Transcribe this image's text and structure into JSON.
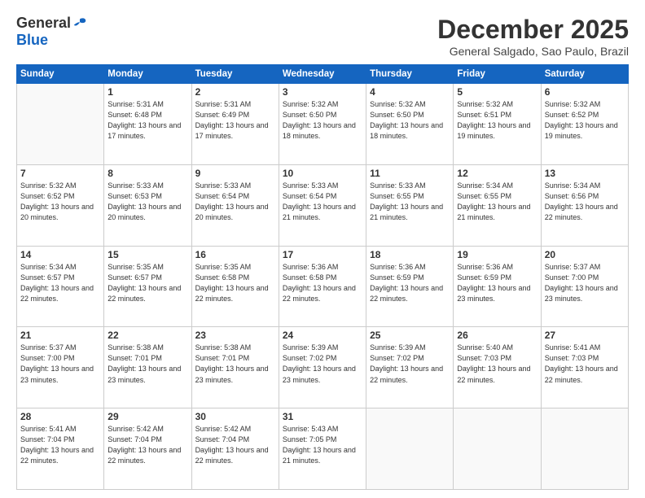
{
  "header": {
    "logo_line1": "General",
    "logo_line2": "Blue",
    "month_year": "December 2025",
    "location": "General Salgado, Sao Paulo, Brazil"
  },
  "days_of_week": [
    "Sunday",
    "Monday",
    "Tuesday",
    "Wednesday",
    "Thursday",
    "Friday",
    "Saturday"
  ],
  "weeks": [
    [
      {
        "day": "",
        "sunrise": "",
        "sunset": "",
        "daylight": ""
      },
      {
        "day": "1",
        "sunrise": "5:31 AM",
        "sunset": "6:48 PM",
        "daylight": "13 hours and 17 minutes."
      },
      {
        "day": "2",
        "sunrise": "5:31 AM",
        "sunset": "6:49 PM",
        "daylight": "13 hours and 17 minutes."
      },
      {
        "day": "3",
        "sunrise": "5:32 AM",
        "sunset": "6:50 PM",
        "daylight": "13 hours and 18 minutes."
      },
      {
        "day": "4",
        "sunrise": "5:32 AM",
        "sunset": "6:50 PM",
        "daylight": "13 hours and 18 minutes."
      },
      {
        "day": "5",
        "sunrise": "5:32 AM",
        "sunset": "6:51 PM",
        "daylight": "13 hours and 19 minutes."
      },
      {
        "day": "6",
        "sunrise": "5:32 AM",
        "sunset": "6:52 PM",
        "daylight": "13 hours and 19 minutes."
      }
    ],
    [
      {
        "day": "7",
        "sunrise": "5:32 AM",
        "sunset": "6:52 PM",
        "daylight": "13 hours and 20 minutes."
      },
      {
        "day": "8",
        "sunrise": "5:33 AM",
        "sunset": "6:53 PM",
        "daylight": "13 hours and 20 minutes."
      },
      {
        "day": "9",
        "sunrise": "5:33 AM",
        "sunset": "6:54 PM",
        "daylight": "13 hours and 20 minutes."
      },
      {
        "day": "10",
        "sunrise": "5:33 AM",
        "sunset": "6:54 PM",
        "daylight": "13 hours and 21 minutes."
      },
      {
        "day": "11",
        "sunrise": "5:33 AM",
        "sunset": "6:55 PM",
        "daylight": "13 hours and 21 minutes."
      },
      {
        "day": "12",
        "sunrise": "5:34 AM",
        "sunset": "6:55 PM",
        "daylight": "13 hours and 21 minutes."
      },
      {
        "day": "13",
        "sunrise": "5:34 AM",
        "sunset": "6:56 PM",
        "daylight": "13 hours and 22 minutes."
      }
    ],
    [
      {
        "day": "14",
        "sunrise": "5:34 AM",
        "sunset": "6:57 PM",
        "daylight": "13 hours and 22 minutes."
      },
      {
        "day": "15",
        "sunrise": "5:35 AM",
        "sunset": "6:57 PM",
        "daylight": "13 hours and 22 minutes."
      },
      {
        "day": "16",
        "sunrise": "5:35 AM",
        "sunset": "6:58 PM",
        "daylight": "13 hours and 22 minutes."
      },
      {
        "day": "17",
        "sunrise": "5:36 AM",
        "sunset": "6:58 PM",
        "daylight": "13 hours and 22 minutes."
      },
      {
        "day": "18",
        "sunrise": "5:36 AM",
        "sunset": "6:59 PM",
        "daylight": "13 hours and 22 minutes."
      },
      {
        "day": "19",
        "sunrise": "5:36 AM",
        "sunset": "6:59 PM",
        "daylight": "13 hours and 23 minutes."
      },
      {
        "day": "20",
        "sunrise": "5:37 AM",
        "sunset": "7:00 PM",
        "daylight": "13 hours and 23 minutes."
      }
    ],
    [
      {
        "day": "21",
        "sunrise": "5:37 AM",
        "sunset": "7:00 PM",
        "daylight": "13 hours and 23 minutes."
      },
      {
        "day": "22",
        "sunrise": "5:38 AM",
        "sunset": "7:01 PM",
        "daylight": "13 hours and 23 minutes."
      },
      {
        "day": "23",
        "sunrise": "5:38 AM",
        "sunset": "7:01 PM",
        "daylight": "13 hours and 23 minutes."
      },
      {
        "day": "24",
        "sunrise": "5:39 AM",
        "sunset": "7:02 PM",
        "daylight": "13 hours and 23 minutes."
      },
      {
        "day": "25",
        "sunrise": "5:39 AM",
        "sunset": "7:02 PM",
        "daylight": "13 hours and 22 minutes."
      },
      {
        "day": "26",
        "sunrise": "5:40 AM",
        "sunset": "7:03 PM",
        "daylight": "13 hours and 22 minutes."
      },
      {
        "day": "27",
        "sunrise": "5:41 AM",
        "sunset": "7:03 PM",
        "daylight": "13 hours and 22 minutes."
      }
    ],
    [
      {
        "day": "28",
        "sunrise": "5:41 AM",
        "sunset": "7:04 PM",
        "daylight": "13 hours and 22 minutes."
      },
      {
        "day": "29",
        "sunrise": "5:42 AM",
        "sunset": "7:04 PM",
        "daylight": "13 hours and 22 minutes."
      },
      {
        "day": "30",
        "sunrise": "5:42 AM",
        "sunset": "7:04 PM",
        "daylight": "13 hours and 22 minutes."
      },
      {
        "day": "31",
        "sunrise": "5:43 AM",
        "sunset": "7:05 PM",
        "daylight": "13 hours and 21 minutes."
      },
      {
        "day": "",
        "sunrise": "",
        "sunset": "",
        "daylight": ""
      },
      {
        "day": "",
        "sunrise": "",
        "sunset": "",
        "daylight": ""
      },
      {
        "day": "",
        "sunrise": "",
        "sunset": "",
        "daylight": ""
      }
    ]
  ]
}
